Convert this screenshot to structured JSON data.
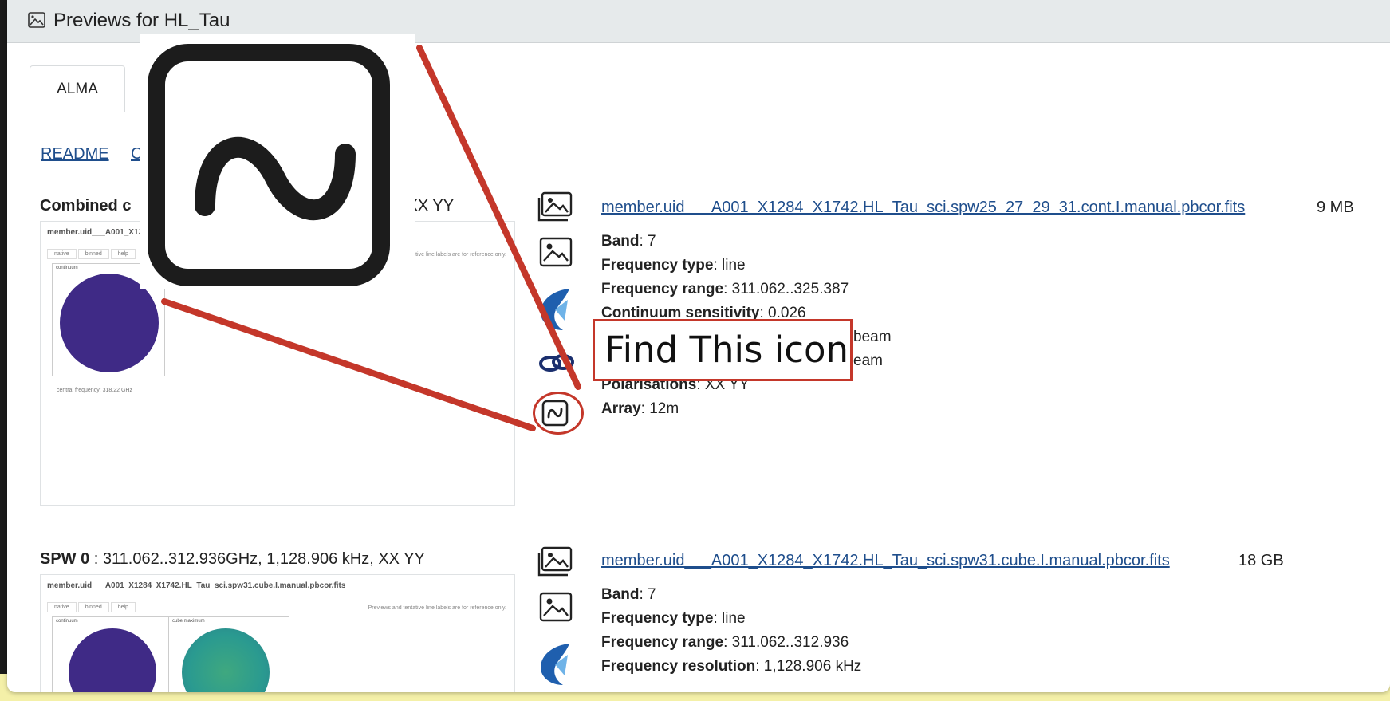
{
  "window": {
    "title": "Previews for HL_Tau"
  },
  "tabs": [
    {
      "label": "ALMA"
    }
  ],
  "links": {
    "readme": "README",
    "second": "C"
  },
  "sections": [
    {
      "heading_bold": "Combined c",
      "heading_rest": "iz, XX YY",
      "thumbnail": {
        "name": "member.uid___A001_X12",
        "tabs": [
          "native",
          "binned",
          "help"
        ],
        "note": "Previews and tentative line labels are for reference only.",
        "plot_label": "continuum",
        "freq_text": "central frequency: 318.22 GHz"
      },
      "file": {
        "name": "member.uid___A001_X1284_X1742.HL_Tau_sci.spw25_27_29_31.cont.I.manual.pbcor.fits",
        "size": "9 MB"
      },
      "properties": [
        {
          "label": "Band",
          "value": ": 7"
        },
        {
          "label": "Frequency type",
          "value": ": line"
        },
        {
          "label": "Frequency range",
          "value": ": 311.062..325.387"
        },
        {
          "label": "Continuum sensitivity",
          "value": ": 0.026"
        },
        {
          "label": "",
          "value": "beam"
        },
        {
          "label": "",
          "value": "eam"
        },
        {
          "label": "Polarisations",
          "value": ": XX YY"
        },
        {
          "label": "Array",
          "value": ": 12m"
        }
      ]
    },
    {
      "heading_bold": "SPW 0",
      "heading_rest": " : 311.062..312.936GHz, 1,128.906 kHz, XX YY",
      "thumbnail": {
        "name": "member.uid___A001_X1284_X1742.HL_Tau_sci.spw31.cube.I.manual.pbcor.fits",
        "tabs": [
          "native",
          "binned",
          "help"
        ],
        "note": "Previews and tentative line labels are for reference only.",
        "plot_label": "continuum",
        "plot_label_2": "cube maximum"
      },
      "file": {
        "name": "member.uid___A001_X1284_X1742.HL_Tau_sci.spw31.cube.I.manual.pbcor.fits",
        "size": "18 GB"
      },
      "properties": [
        {
          "label": "Band",
          "value": ": 7"
        },
        {
          "label": "Frequency type",
          "value": ": line"
        },
        {
          "label": "Frequency range",
          "value": ": 311.062..312.936"
        },
        {
          "label": "Frequency resolution",
          "value": ": 1,128.906 kHz"
        }
      ]
    }
  ],
  "annotation": {
    "callout_text": "Find This icon",
    "target_icon": "spectrum-wave-icon"
  },
  "colors": {
    "accent": "#c4372a",
    "link": "#1f4e8c",
    "header_bg": "#e6eaeb"
  }
}
